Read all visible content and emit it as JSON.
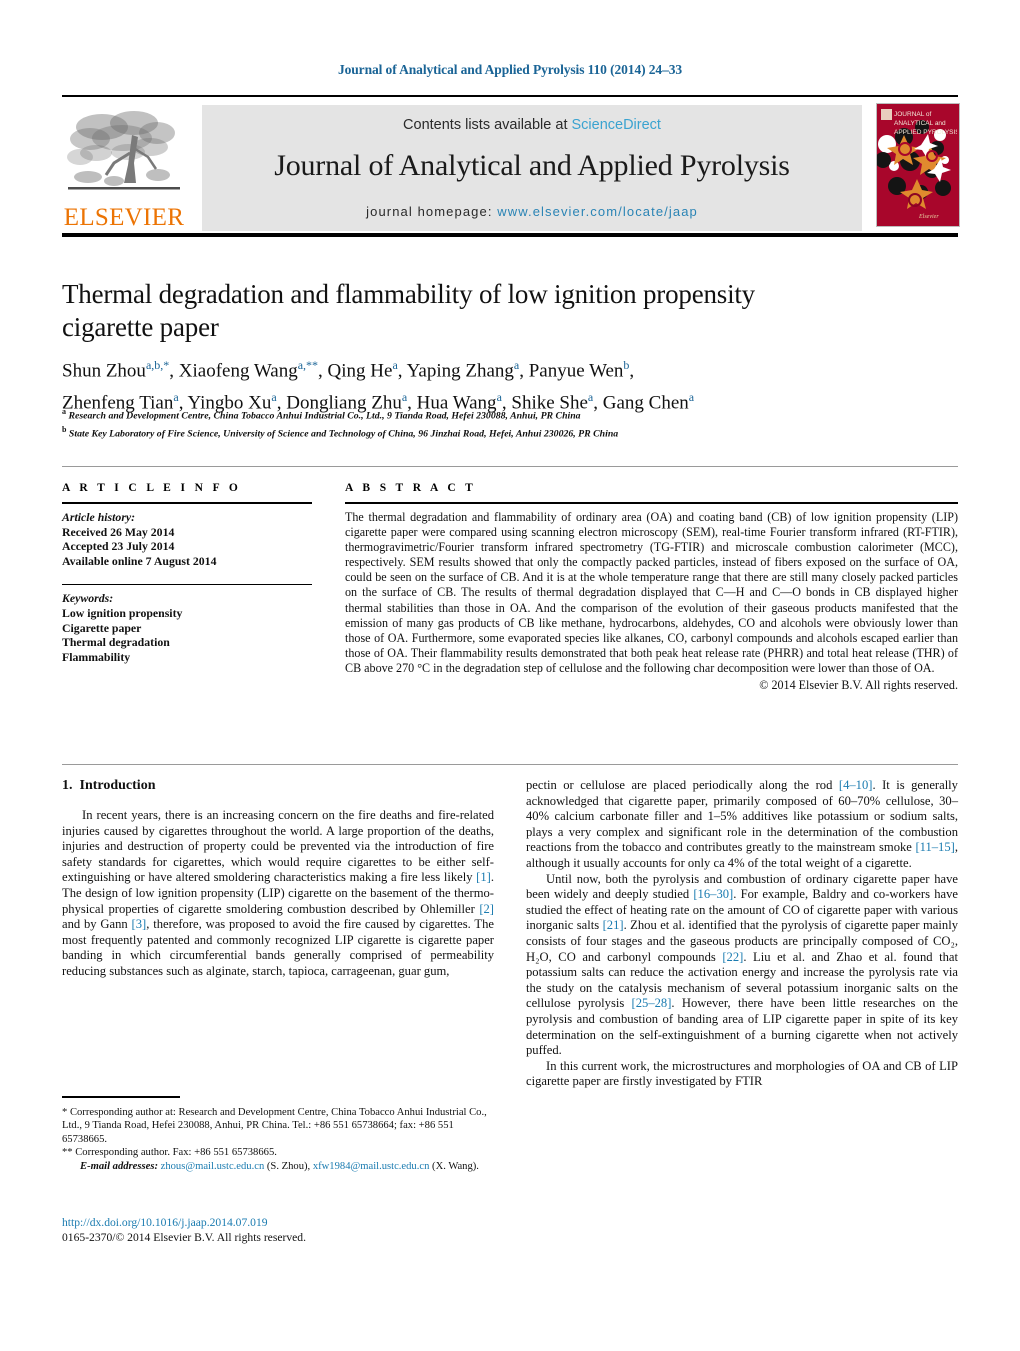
{
  "running_head": "Journal of Analytical and Applied Pyrolysis 110 (2014) 24–33",
  "masthead": {
    "contents_prefix": "Contents lists available at ",
    "contents_link": "ScienceDirect",
    "journal_title": "Journal of Analytical and Applied Pyrolysis",
    "homepage_prefix": "journal homepage: ",
    "homepage_url": "www.elsevier.com/locate/jaap",
    "publisher": "ELSEVIER",
    "cover_title_line1": "JOURNAL of",
    "cover_title_line2": "ANALYTICAL and",
    "cover_title_line3": "APPLIED PYROLYSIS",
    "accent_link_color": "#3aa3d0",
    "cover_bg_color": "#a8062b",
    "cover_accent_color": "#e08a2e",
    "elsevier_orange": "#ec7404"
  },
  "article": {
    "title": "Thermal degradation and flammability of low ignition propensity cigarette paper",
    "authors_line1": [
      {
        "name": "Shun Zhou",
        "marks": "a,b,*"
      },
      {
        "name": "Xiaofeng Wang",
        "marks": "a,**"
      },
      {
        "name": "Qing He",
        "marks": "a"
      },
      {
        "name": "Yaping Zhang",
        "marks": "a"
      },
      {
        "name": "Panyue Wen",
        "marks": "b"
      }
    ],
    "authors_line2": [
      {
        "name": "Zhenfeng Tian",
        "marks": "a"
      },
      {
        "name": "Yingbo Xu",
        "marks": "a"
      },
      {
        "name": "Dongliang Zhu",
        "marks": "a"
      },
      {
        "name": "Hua Wang",
        "marks": "a"
      },
      {
        "name": "Shike She",
        "marks": "a"
      },
      {
        "name": "Gang Chen",
        "marks": "a"
      }
    ],
    "affiliations": [
      {
        "mark": "a",
        "text": "Research and Development Centre, China Tobacco Anhui Industrial Co., Ltd., 9 Tianda Road, Hefei 230088, Anhui, PR China"
      },
      {
        "mark": "b",
        "text": "State Key Laboratory of Fire Science, University of Science and Technology of China, 96 Jinzhai Road, Hefei, Anhui 230026, PR China"
      }
    ]
  },
  "article_info": {
    "heading": "A R T I C L E  I N F O",
    "history_label": "Article history:",
    "history": [
      "Received 26 May 2014",
      "Accepted 23 July 2014",
      "Available online 7 August 2014"
    ],
    "keywords_label": "Keywords:",
    "keywords": [
      "Low ignition propensity",
      "Cigarette paper",
      "Thermal degradation",
      "Flammability"
    ]
  },
  "abstract": {
    "heading": "A B S T R A C T",
    "text": "The thermal degradation and flammability of ordinary area (OA) and coating band (CB) of low ignition propensity (LIP) cigarette paper were compared using scanning electron microscopy (SEM), real-time Fourier transform infrared (RT-FTIR), thermogravimetric/Fourier transform infrared spectrometry (TG-FTIR) and microscale combustion calorimeter (MCC), respectively. SEM results showed that only the compactly packed particles, instead of fibers exposed on the surface of OA, could be seen on the surface of CB. And it is at the whole temperature range that there are still many closely packed particles on the surface of CB. The results of thermal degradation displayed that C—H and C—O bonds in CB displayed higher thermal stabilities than those in OA. And the comparison of the evolution of their gaseous products manifested that the emission of many gas products of CB like methane, hydrocarbons, aldehydes, CO and alcohols were obviously lower than those of OA. Furthermore, some evaporated species like alkanes, CO, carbonyl compounds and alcohols escaped earlier than those of OA. Their flammability results demonstrated that both peak heat release rate (PHRR) and total heat release (THR) of CB above 270 °C in the degradation step of cellulose and the following char decomposition were lower than those of OA.",
    "copyright": "© 2014 Elsevier B.V. All rights reserved."
  },
  "introduction": {
    "number": "1.",
    "heading": "Introduction",
    "left_paragraphs": [
      "In recent years, there is an increasing concern on the fire deaths and fire-related injuries caused by cigarettes throughout the world. A large proportion of the deaths, injuries and destruction of property could be prevented via the introduction of fire safety standards for cigarettes, which would require cigarettes to be either self-extinguishing or have altered smoldering characteristics making a fire less likely [1]. The design of low ignition propensity (LIP) cigarette on the basement of the thermo-physical properties of cigarette smoldering combustion described by Ohlemiller [2] and by Gann [3], therefore, was proposed to avoid the fire caused by cigarettes. The most frequently patented and commonly recognized LIP cigarette is cigarette paper banding in which circumferential bands generally comprised of permeability reducing substances such as alginate, starch, tapioca, carrageenan, guar gum,"
    ],
    "right_paragraphs": [
      "pectin or cellulose are placed periodically along the rod [4–10]. It is generally acknowledged that cigarette paper, primarily composed of 60–70% cellulose, 30–40% calcium carbonate filler and 1–5% additives like potassium or sodium salts, plays a very complex and significant role in the determination of the combustion reactions from the tobacco and contributes greatly to the mainstream smoke [11–15], although it usually accounts for only ca 4% of the total weight of a cigarette.",
      "Until now, both the pyrolysis and combustion of ordinary cigarette paper have been widely and deeply studied [16–30]. For example, Baldry and co-workers have studied the effect of heating rate on the amount of CO of cigarette paper with various inorganic salts [21]. Zhou et al. identified that the pyrolysis of cigarette paper mainly consists of four stages and the gaseous products are principally composed of CO2, H2O, CO and carbonyl compounds [22]. Liu et al. and Zhao et al. found that potassium salts can reduce the activation energy and increase the pyrolysis rate via the study on the catalysis mechanism of several potassium inorganic salts on the cellulose pyrolysis [25–28]. However, there have been little researches on the pyrolysis and combustion of banding area of LIP cigarette paper in spite of its key determination on the self-extinguishment of a burning cigarette when not actively puffed.",
      "In this current work, the microstructures and morphologies of OA and CB of LIP cigarette paper are firstly investigated by FTIR"
    ]
  },
  "footnotes": {
    "corresponding_1": "* Corresponding author at: Research and Development Centre, China Tobacco Anhui Industrial Co., Ltd., 9 Tianda Road, Hefei 230088, Anhui, PR China. Tel.: +86 551 65738664; fax: +86 551 65738665.",
    "corresponding_2": "** Corresponding author. Fax: +86 551 65738665.",
    "email_label": "E-mail addresses:",
    "email_1": "zhous@mail.ustc.edu.cn",
    "email_1_owner": "(S. Zhou),",
    "email_2": "xfw1984@mail.ustc.edu.cn",
    "email_2_owner": "(X. Wang)."
  },
  "doi_block": {
    "doi_url": "http://dx.doi.org/10.1016/j.jaap.2014.07.019",
    "issn_line": "0165-2370/© 2014 Elsevier B.V. All rights reserved."
  }
}
